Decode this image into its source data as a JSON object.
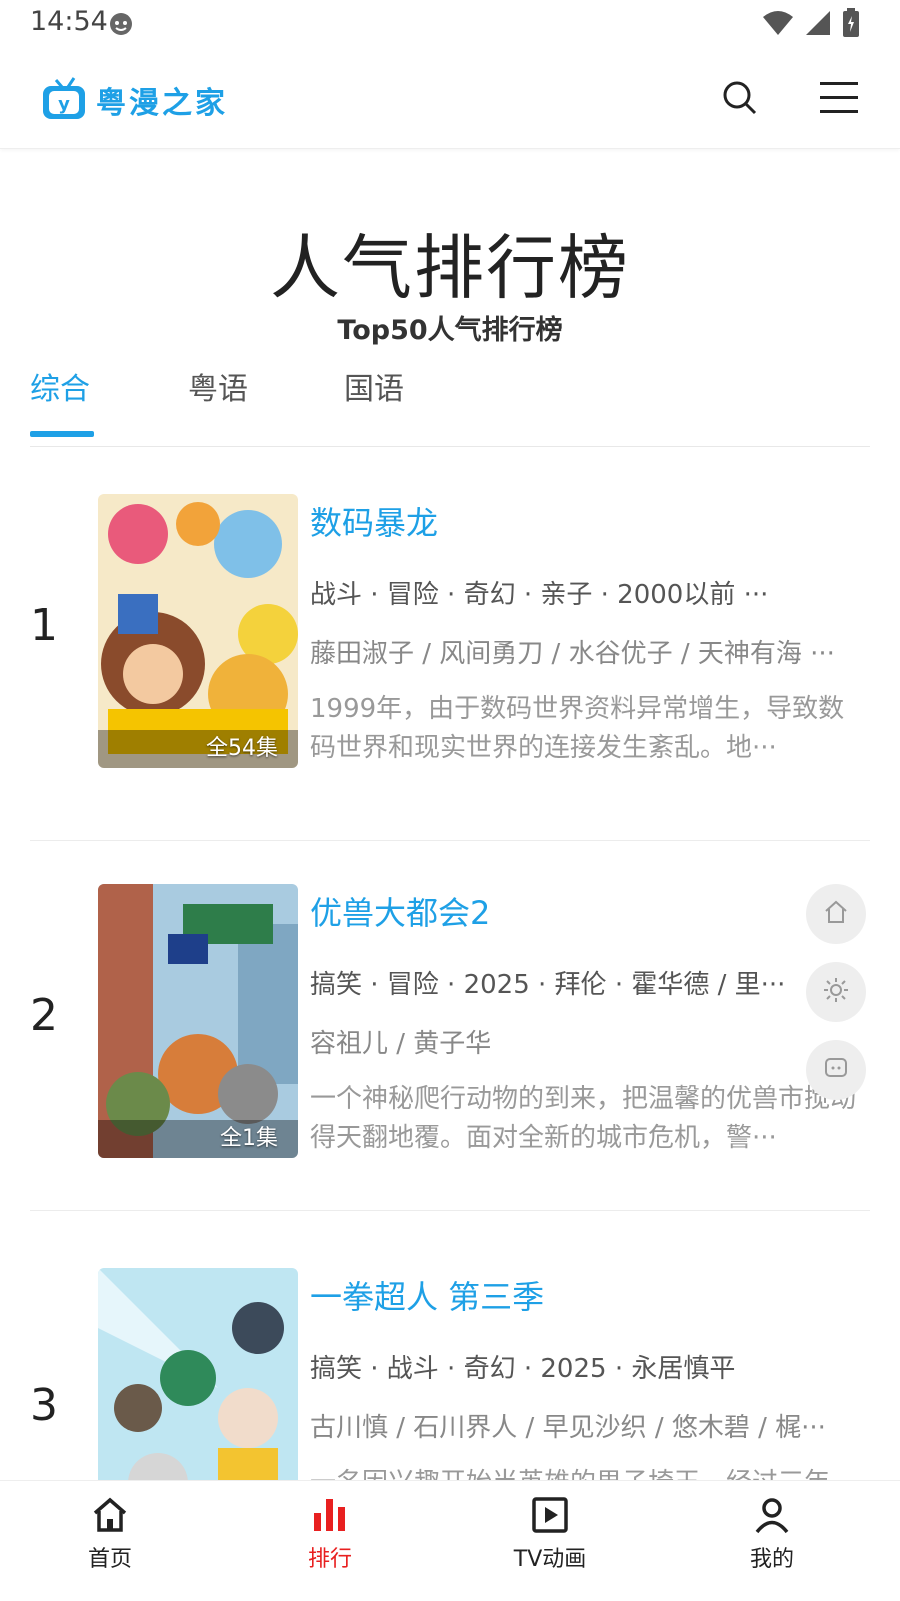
{
  "status_bar": {
    "time": "14:54"
  },
  "header": {
    "logo_text": "粤漫之家"
  },
  "page": {
    "title": "人气排行榜",
    "subtitle": "Top50人气排行榜"
  },
  "tabs": [
    {
      "label": "综合",
      "active": true
    },
    {
      "label": "粤语",
      "active": false
    },
    {
      "label": "国语",
      "active": false
    }
  ],
  "ranking": [
    {
      "rank": "1",
      "title": "数码暴龙",
      "episodes": "全54集",
      "tags": "战斗 · 冒险 · 奇幻 · 亲子 · 2000以前 ···",
      "cast": "藤田淑子 / 风间勇刀 / 水谷优子 / 天神有海 ···",
      "desc": "1999年，由于数码世界资料异常增生，导致数码世界和现实世界的连接发生紊乱。地···"
    },
    {
      "rank": "2",
      "title": "优兽大都会2",
      "episodes": "全1集",
      "tags": "搞笑 · 冒险 · 2025 · 拜伦 · 霍华德 / 里···",
      "cast": "容祖儿 / 黄子华",
      "desc": "一个神秘爬行动物的到来，把温馨的优兽市搅动得天翻地覆。面对全新的城市危机，警···"
    },
    {
      "rank": "3",
      "title": "一拳超人 第三季",
      "episodes": "",
      "tags": "搞笑 · 战斗 · 奇幻 · 2025 · 永居慎平",
      "cast": "古川慎 / 石川界人 / 早见沙织 / 悠木碧 / 梶···",
      "desc": "一名因兴趣开始当英雄的男子埼玉，经过三年"
    }
  ],
  "bottom_nav": [
    {
      "label": "首页",
      "active": false
    },
    {
      "label": "排行",
      "active": true
    },
    {
      "label": "TV动画",
      "active": false
    },
    {
      "label": "我的",
      "active": false
    }
  ],
  "colors": {
    "accent": "#1ea0e6",
    "active_nav": "#e82020"
  }
}
